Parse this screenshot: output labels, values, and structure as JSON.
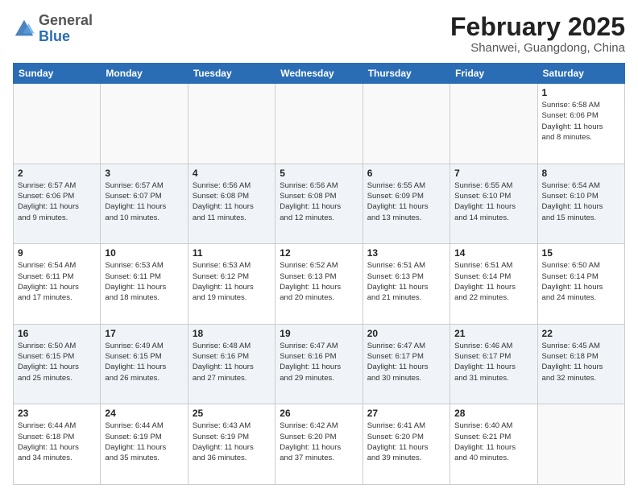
{
  "logo": {
    "general": "General",
    "blue": "Blue"
  },
  "title": "February 2025",
  "subtitle": "Shanwei, Guangdong, China",
  "weekdays": [
    "Sunday",
    "Monday",
    "Tuesday",
    "Wednesday",
    "Thursday",
    "Friday",
    "Saturday"
  ],
  "weeks": [
    [
      {
        "day": "",
        "info": ""
      },
      {
        "day": "",
        "info": ""
      },
      {
        "day": "",
        "info": ""
      },
      {
        "day": "",
        "info": ""
      },
      {
        "day": "",
        "info": ""
      },
      {
        "day": "",
        "info": ""
      },
      {
        "day": "1",
        "info": "Sunrise: 6:58 AM\nSunset: 6:06 PM\nDaylight: 11 hours\nand 8 minutes."
      }
    ],
    [
      {
        "day": "2",
        "info": "Sunrise: 6:57 AM\nSunset: 6:06 PM\nDaylight: 11 hours\nand 9 minutes."
      },
      {
        "day": "3",
        "info": "Sunrise: 6:57 AM\nSunset: 6:07 PM\nDaylight: 11 hours\nand 10 minutes."
      },
      {
        "day": "4",
        "info": "Sunrise: 6:56 AM\nSunset: 6:08 PM\nDaylight: 11 hours\nand 11 minutes."
      },
      {
        "day": "5",
        "info": "Sunrise: 6:56 AM\nSunset: 6:08 PM\nDaylight: 11 hours\nand 12 minutes."
      },
      {
        "day": "6",
        "info": "Sunrise: 6:55 AM\nSunset: 6:09 PM\nDaylight: 11 hours\nand 13 minutes."
      },
      {
        "day": "7",
        "info": "Sunrise: 6:55 AM\nSunset: 6:10 PM\nDaylight: 11 hours\nand 14 minutes."
      },
      {
        "day": "8",
        "info": "Sunrise: 6:54 AM\nSunset: 6:10 PM\nDaylight: 11 hours\nand 15 minutes."
      }
    ],
    [
      {
        "day": "9",
        "info": "Sunrise: 6:54 AM\nSunset: 6:11 PM\nDaylight: 11 hours\nand 17 minutes."
      },
      {
        "day": "10",
        "info": "Sunrise: 6:53 AM\nSunset: 6:11 PM\nDaylight: 11 hours\nand 18 minutes."
      },
      {
        "day": "11",
        "info": "Sunrise: 6:53 AM\nSunset: 6:12 PM\nDaylight: 11 hours\nand 19 minutes."
      },
      {
        "day": "12",
        "info": "Sunrise: 6:52 AM\nSunset: 6:13 PM\nDaylight: 11 hours\nand 20 minutes."
      },
      {
        "day": "13",
        "info": "Sunrise: 6:51 AM\nSunset: 6:13 PM\nDaylight: 11 hours\nand 21 minutes."
      },
      {
        "day": "14",
        "info": "Sunrise: 6:51 AM\nSunset: 6:14 PM\nDaylight: 11 hours\nand 22 minutes."
      },
      {
        "day": "15",
        "info": "Sunrise: 6:50 AM\nSunset: 6:14 PM\nDaylight: 11 hours\nand 24 minutes."
      }
    ],
    [
      {
        "day": "16",
        "info": "Sunrise: 6:50 AM\nSunset: 6:15 PM\nDaylight: 11 hours\nand 25 minutes."
      },
      {
        "day": "17",
        "info": "Sunrise: 6:49 AM\nSunset: 6:15 PM\nDaylight: 11 hours\nand 26 minutes."
      },
      {
        "day": "18",
        "info": "Sunrise: 6:48 AM\nSunset: 6:16 PM\nDaylight: 11 hours\nand 27 minutes."
      },
      {
        "day": "19",
        "info": "Sunrise: 6:47 AM\nSunset: 6:16 PM\nDaylight: 11 hours\nand 29 minutes."
      },
      {
        "day": "20",
        "info": "Sunrise: 6:47 AM\nSunset: 6:17 PM\nDaylight: 11 hours\nand 30 minutes."
      },
      {
        "day": "21",
        "info": "Sunrise: 6:46 AM\nSunset: 6:17 PM\nDaylight: 11 hours\nand 31 minutes."
      },
      {
        "day": "22",
        "info": "Sunrise: 6:45 AM\nSunset: 6:18 PM\nDaylight: 11 hours\nand 32 minutes."
      }
    ],
    [
      {
        "day": "23",
        "info": "Sunrise: 6:44 AM\nSunset: 6:18 PM\nDaylight: 11 hours\nand 34 minutes."
      },
      {
        "day": "24",
        "info": "Sunrise: 6:44 AM\nSunset: 6:19 PM\nDaylight: 11 hours\nand 35 minutes."
      },
      {
        "day": "25",
        "info": "Sunrise: 6:43 AM\nSunset: 6:19 PM\nDaylight: 11 hours\nand 36 minutes."
      },
      {
        "day": "26",
        "info": "Sunrise: 6:42 AM\nSunset: 6:20 PM\nDaylight: 11 hours\nand 37 minutes."
      },
      {
        "day": "27",
        "info": "Sunrise: 6:41 AM\nSunset: 6:20 PM\nDaylight: 11 hours\nand 39 minutes."
      },
      {
        "day": "28",
        "info": "Sunrise: 6:40 AM\nSunset: 6:21 PM\nDaylight: 11 hours\nand 40 minutes."
      },
      {
        "day": "",
        "info": ""
      }
    ]
  ]
}
